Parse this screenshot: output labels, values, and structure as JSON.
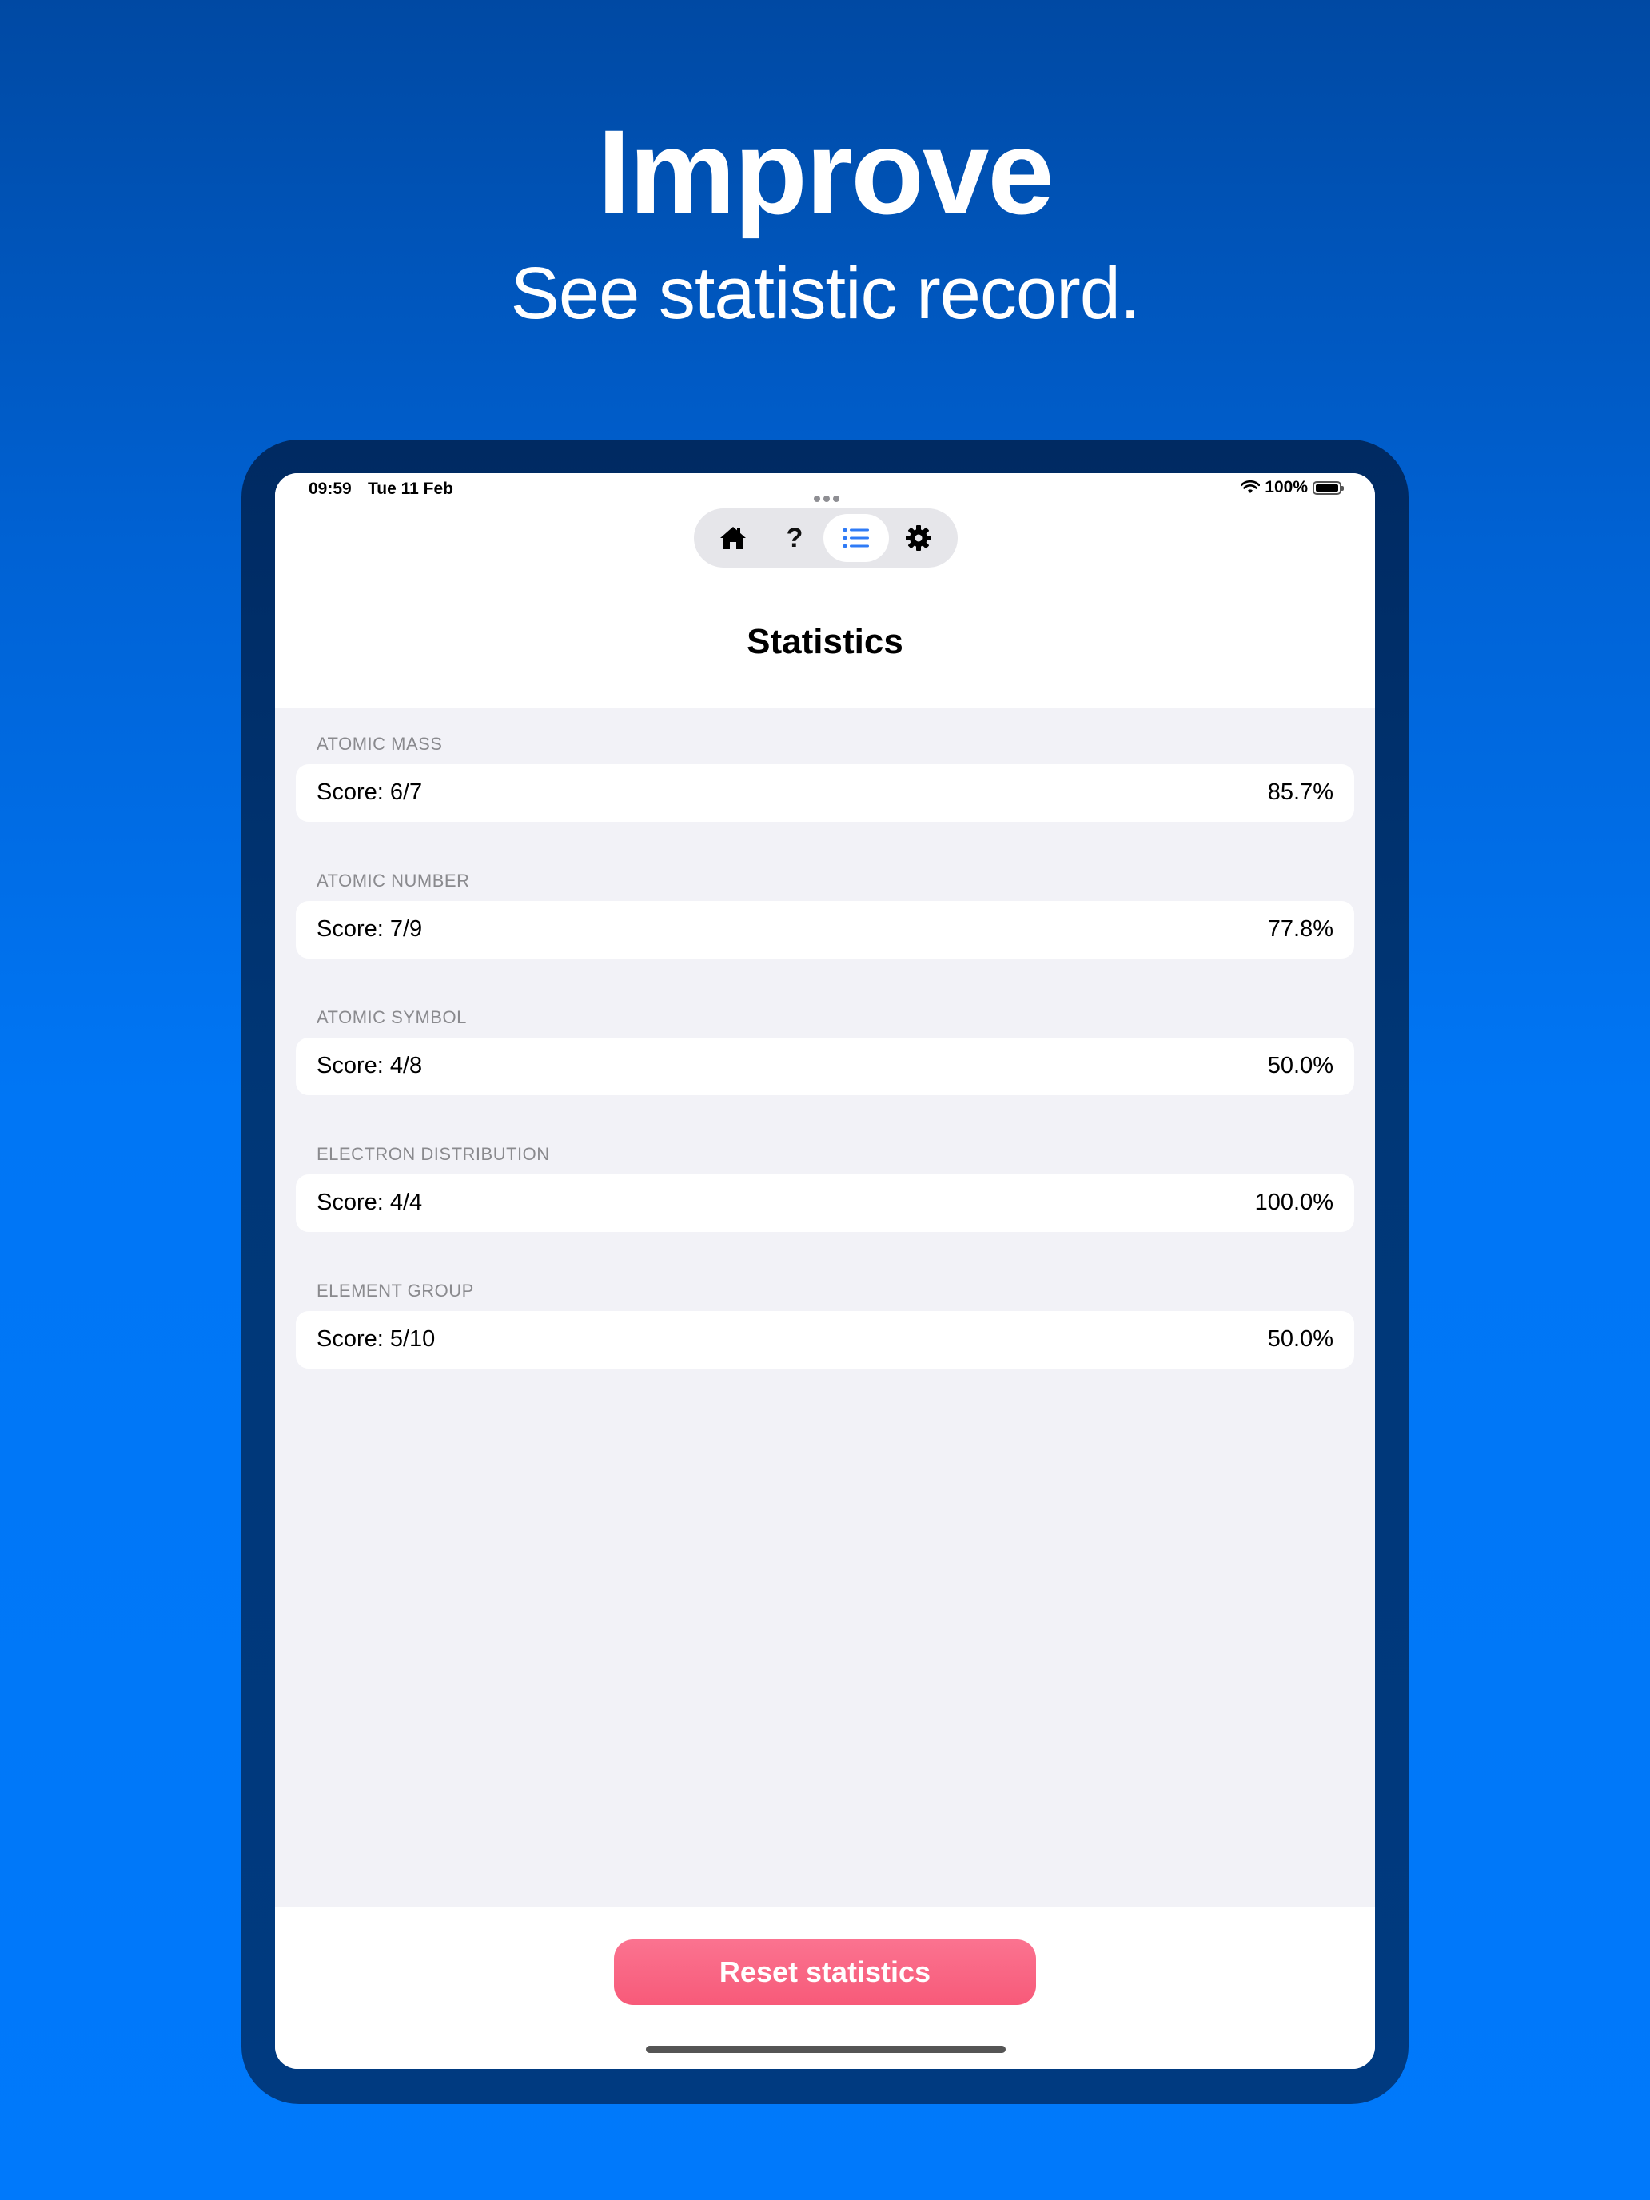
{
  "marketing": {
    "headline": "Improve",
    "subhead": "See statistic record."
  },
  "status_bar": {
    "time": "09:59",
    "date": "Tue 11 Feb",
    "battery": "100%"
  },
  "tabs": [
    {
      "icon": "house-icon",
      "active": false
    },
    {
      "icon": "question-icon",
      "label": "?",
      "active": false
    },
    {
      "icon": "list-icon",
      "active": true
    },
    {
      "icon": "gear-icon",
      "active": false
    }
  ],
  "page_title": "Statistics",
  "sections": [
    {
      "label": "ATOMIC MASS",
      "score": "Score: 6/7",
      "percent": "85.7%"
    },
    {
      "label": "ATOMIC NUMBER",
      "score": "Score: 7/9",
      "percent": "77.8%"
    },
    {
      "label": "ATOMIC SYMBOL",
      "score": "Score: 4/8",
      "percent": "50.0%"
    },
    {
      "label": "ELECTRON DISTRIBUTION",
      "score": "Score: 4/4",
      "percent": "100.0%"
    },
    {
      "label": "ELEMENT GROUP",
      "score": "Score: 5/10",
      "percent": "50.0%"
    }
  ],
  "reset_label": "Reset statistics",
  "colors": {
    "accent": "#2f7bf6",
    "reset_button": "#f75a79"
  }
}
